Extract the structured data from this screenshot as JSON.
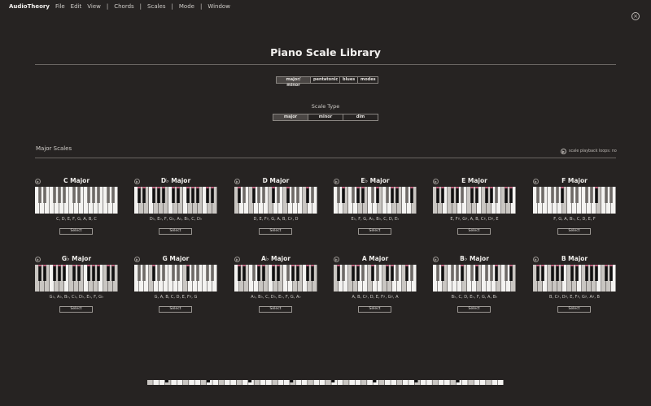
{
  "menu": {
    "app": "AudioTheory",
    "items": [
      "File",
      "Edit",
      "View",
      "|",
      "Chords",
      "|",
      "Scales",
      "|",
      "Mode",
      "|",
      "Window"
    ]
  },
  "close_glyph": "×",
  "page_title": "Piano Scale Library",
  "category_tabs": [
    "major/ minor",
    "pentatonic",
    "blues",
    "modes"
  ],
  "scale_type_label": "Scale Type",
  "scale_types": [
    "major",
    "minor",
    "dim"
  ],
  "section_title": "Major Scales",
  "loop_toggle": "scale playback loops: no",
  "select_label": "Select",
  "play_glyph": "▶",
  "scales": [
    {
      "name": "C Major",
      "notes": "C, D, E, F, G, A, B, C",
      "keys": [
        0,
        2,
        4,
        5,
        7,
        9,
        11
      ]
    },
    {
      "name": "D♭ Major",
      "notes": "D♭, E♭, F, G♭, A♭, B♭, C, D♭",
      "keys": [
        1,
        3,
        5,
        6,
        8,
        10,
        0
      ]
    },
    {
      "name": "D Major",
      "notes": "D, E, F♯, G, A, B, C♯, D",
      "keys": [
        2,
        4,
        6,
        7,
        9,
        11,
        1
      ]
    },
    {
      "name": "E♭ Major",
      "notes": "E♭, F, G, A♭, B♭, C, D, E♭",
      "keys": [
        3,
        5,
        7,
        8,
        10,
        0,
        2
      ]
    },
    {
      "name": "E Major",
      "notes": "E, F♯, G♯, A, B, C♯, D♯, E",
      "keys": [
        4,
        6,
        8,
        9,
        11,
        1,
        3
      ]
    },
    {
      "name": "F Major",
      "notes": "F, G, A, B♭, C, D, E, F",
      "keys": [
        5,
        7,
        9,
        10,
        0,
        2,
        4
      ]
    },
    {
      "name": "G♭ Major",
      "notes": "G♭, A♭, B♭, C♭, D♭, E♭, F, G♭",
      "keys": [
        6,
        8,
        10,
        11,
        1,
        3,
        5
      ]
    },
    {
      "name": "G Major",
      "notes": "G, A, B, C, D, E, F♯, G",
      "keys": [
        7,
        9,
        11,
        0,
        2,
        4,
        6
      ]
    },
    {
      "name": "A♭ Major",
      "notes": "A♭, B♭, C, D♭, E♭, F, G, A♭",
      "keys": [
        8,
        10,
        0,
        1,
        3,
        5,
        7
      ]
    },
    {
      "name": "A Major",
      "notes": "A, B, C♯, D, E, F♯, G♯, A",
      "keys": [
        9,
        11,
        1,
        2,
        4,
        6,
        8
      ]
    },
    {
      "name": "B♭ Major",
      "notes": "B♭, C, D, E♭, F, G, A, B♭",
      "keys": [
        10,
        0,
        2,
        3,
        5,
        7,
        9
      ]
    },
    {
      "name": "B Major",
      "notes": "B, C♯, D♯, E, F♯, G♯, A♯, B",
      "keys": [
        11,
        1,
        3,
        4,
        6,
        8,
        10
      ]
    }
  ],
  "colors": {
    "background": "#262322",
    "key_white": "#f4f3f1",
    "key_white_dim": "#c9c6c2",
    "key_black": "#111111",
    "key_black_dim": "#6e6a67",
    "highlight": "#b85a78"
  }
}
